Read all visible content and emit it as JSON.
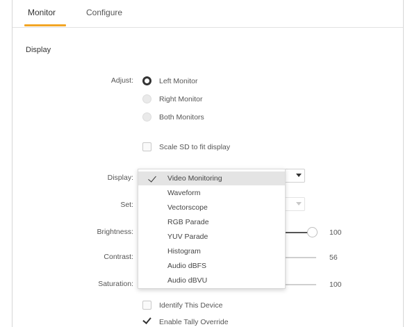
{
  "tabs": [
    {
      "label": "Monitor",
      "active": true
    },
    {
      "label": "Configure",
      "active": false
    }
  ],
  "section": {
    "title": "Display"
  },
  "adjust": {
    "label": "Adjust:",
    "options": [
      "Left Monitor",
      "Right Monitor",
      "Both Monitors"
    ],
    "selected": "Left Monitor"
  },
  "scale_sd": {
    "label": "Scale SD to fit display",
    "checked": false
  },
  "display": {
    "label": "Display:",
    "selected": "Video Monitoring",
    "options": [
      "Video Monitoring",
      "Waveform",
      "Vectorscope",
      "RGB Parade",
      "YUV Parade",
      "Histogram",
      "Audio dBFS",
      "Audio dBVU"
    ]
  },
  "set": {
    "label": "Set:"
  },
  "brightness": {
    "label": "Brightness:",
    "value": "100",
    "fraction": 1.0
  },
  "contrast": {
    "label": "Contrast:",
    "value": "56",
    "fraction": 0.56
  },
  "saturation": {
    "label": "Saturation:",
    "value": "100",
    "fraction": 1.0
  },
  "identify": {
    "label": "Identify This Device",
    "checked": false
  },
  "tally": {
    "label": "Enable Tally Override",
    "checked": true
  },
  "colors": {
    "accent": "#f2a524"
  }
}
